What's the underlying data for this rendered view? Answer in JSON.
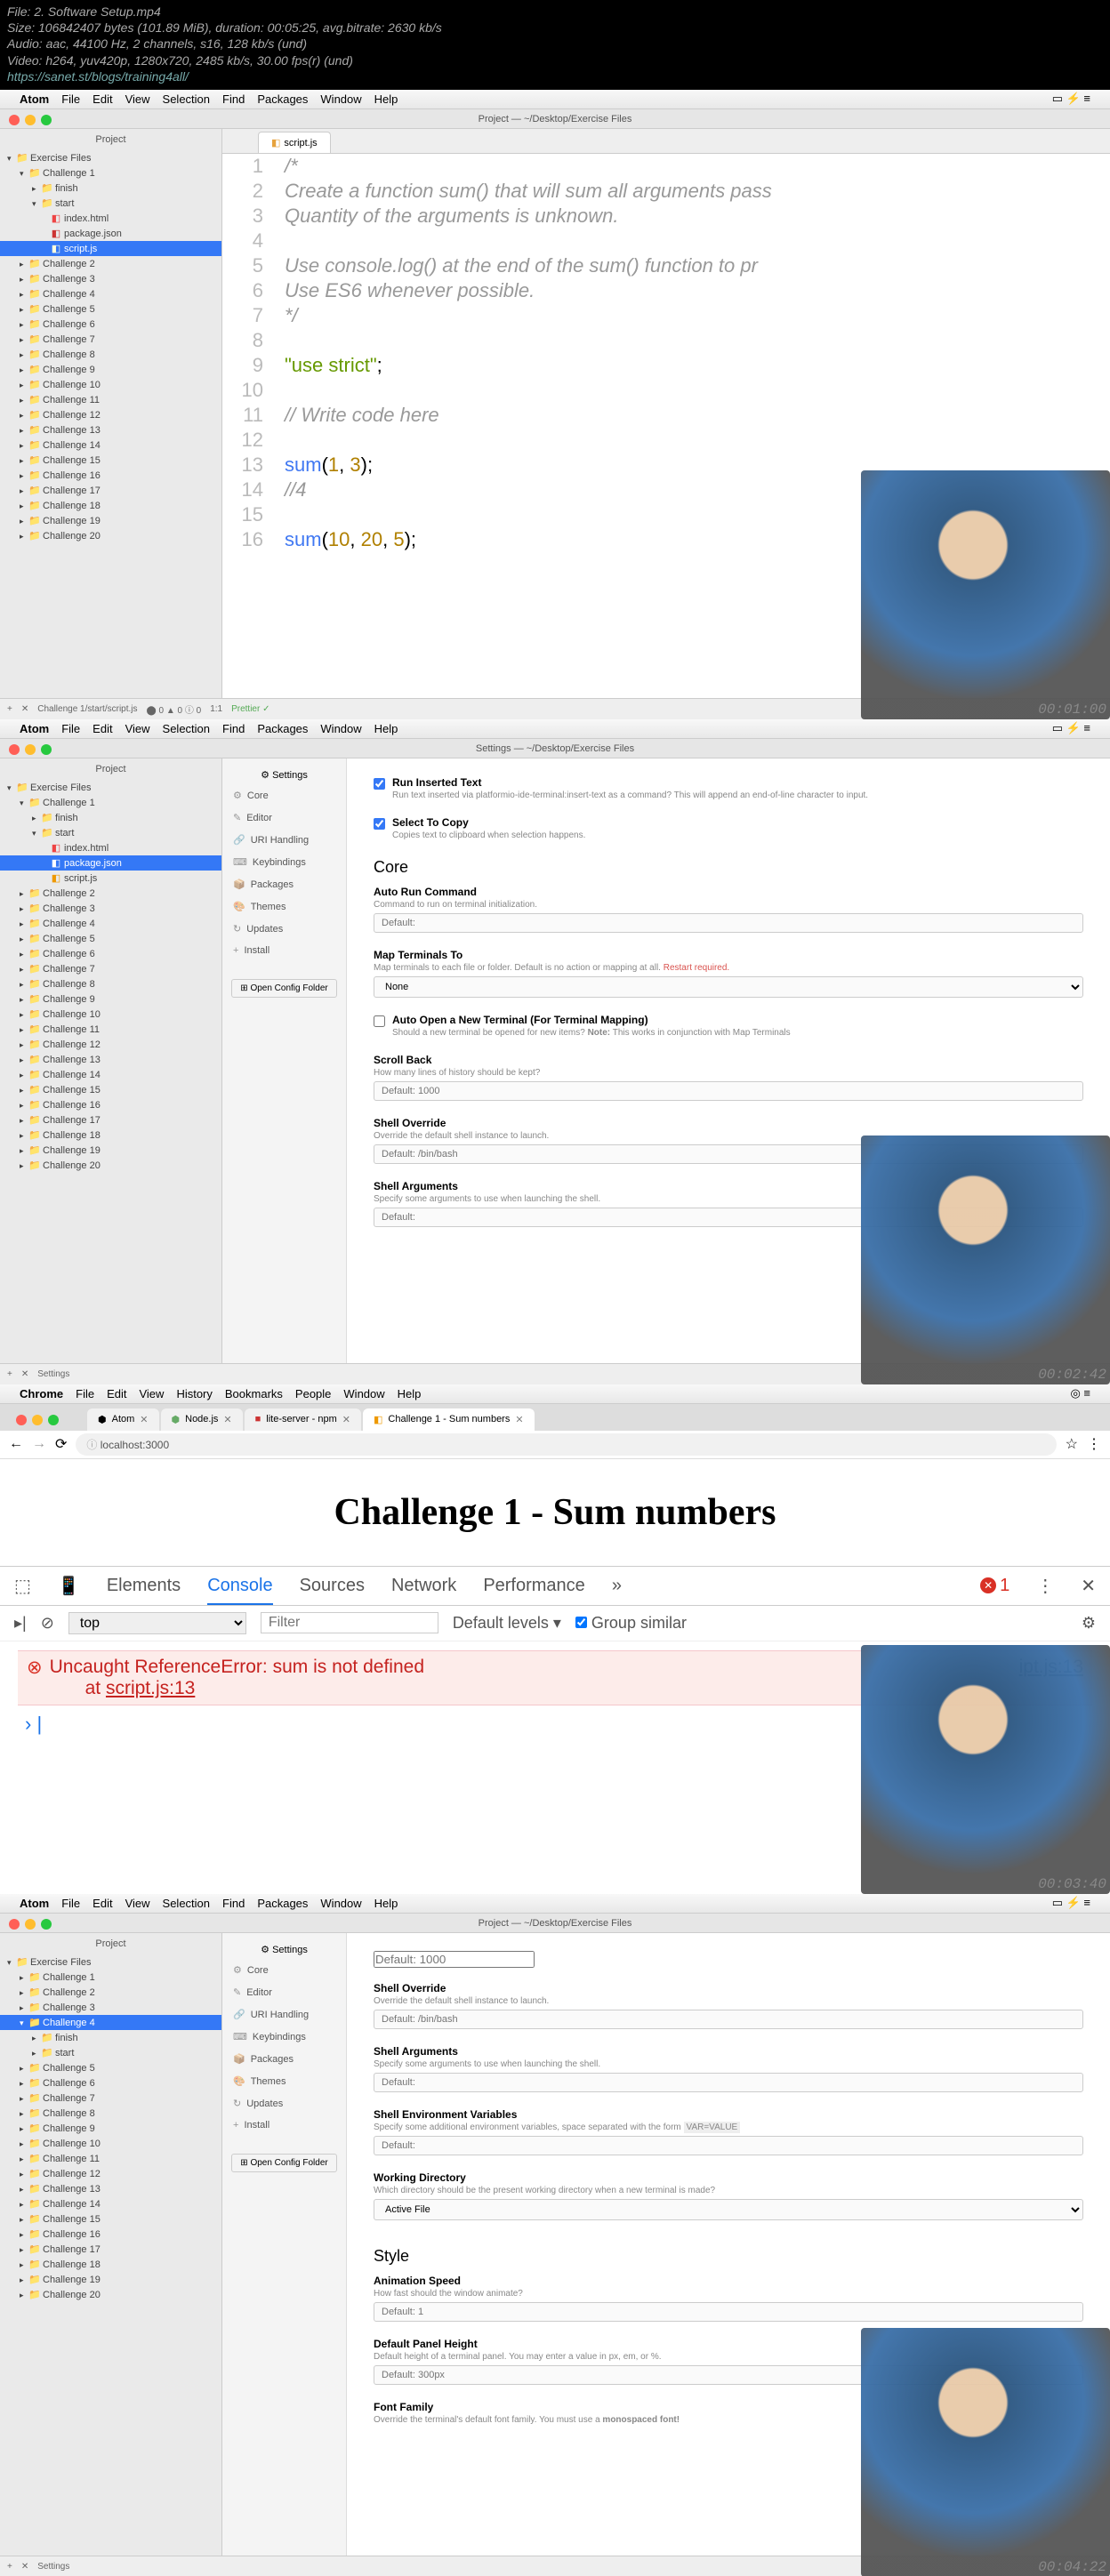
{
  "header": {
    "line1": "File: 2. Software Setup.mp4",
    "line2": "Size: 106842407 bytes (101.89 MiB), duration: 00:05:25, avg.bitrate: 2630 kb/s",
    "line3": "Audio: aac, 44100 Hz, 2 channels, s16, 128 kb/s (und)",
    "line4": "Video: h264, yuv420p, 1280x720, 2485 kb/s, 30.00 fps(r) (und)",
    "url": "https://sanet.st/blogs/training4all/"
  },
  "menubar": {
    "apple": "",
    "atom": "Atom",
    "chrome": "Chrome",
    "items": [
      "File",
      "Edit",
      "View",
      "Selection",
      "Find",
      "Packages",
      "Window",
      "Help"
    ],
    "chrome_items": [
      "File",
      "Edit",
      "View",
      "History",
      "Bookmarks",
      "People",
      "Window",
      "Help"
    ]
  },
  "panel1": {
    "title": "Project — ~/Desktop/Exercise Files",
    "sidebar_title": "Project",
    "tree": {
      "root": "Exercise Files",
      "challenge1": "Challenge 1",
      "finish": "finish",
      "start": "start",
      "index": "index.html",
      "package": "package.json",
      "script": "script.js",
      "challenges": [
        "Challenge 2",
        "Challenge 3",
        "Challenge 4",
        "Challenge 5",
        "Challenge 6",
        "Challenge 7",
        "Challenge 8",
        "Challenge 9",
        "Challenge 10",
        "Challenge 11",
        "Challenge 12",
        "Challenge 13",
        "Challenge 14",
        "Challenge 15",
        "Challenge 16",
        "Challenge 17",
        "Challenge 18",
        "Challenge 19",
        "Challenge 20"
      ]
    },
    "tab": "script.js",
    "code": {
      "l1": "/*",
      "l2": "Create a function sum() that will sum all arguments pass",
      "l3": "Quantity of the arguments is unknown.",
      "l4": "",
      "l5": "Use console.log() at the end of the sum() function to pr",
      "l6": "Use ES6 whenever possible.",
      "l7": "*/",
      "l8": "",
      "l9a": "\"use strict\"",
      "l9b": ";",
      "l10": "",
      "l11": "// Write code here",
      "l12": "",
      "l13a": "sum",
      "l13b": "(",
      "l13c": "1",
      "l13d": ", ",
      "l13e": "3",
      "l13f": ");",
      "l14": "//4",
      "l15": "",
      "l16a": "sum",
      "l16b": "(",
      "l16c": "10",
      "l16d": ", ",
      "l16e": "20",
      "l16f": ", ",
      "l16g": "5",
      "l16h": ");"
    },
    "statusbar": {
      "path": "Challenge 1/start/script.js",
      "pos": "1:1",
      "info": "⬤ 0 ▲ 0 ⓘ 0",
      "prettier": "Prettier ✓"
    },
    "timestamp": "00:01:00"
  },
  "panel2": {
    "title": "Settings — ~/Desktop/Exercise Files",
    "nav_title": "⚙ Settings",
    "nav": {
      "core": "Core",
      "editor": "Editor",
      "uri": "URI Handling",
      "keyb": "Keybindings",
      "pkg": "Packages",
      "themes": "Themes",
      "updates": "Updates",
      "install": "Install",
      "open_config": "⊞ Open Config Folder"
    },
    "settings": {
      "run_inserted": "Run Inserted Text",
      "run_inserted_desc_a": "Run text inserted via ",
      "run_inserted_desc_b": "platformio-ide-terminal:insert-text",
      "run_inserted_desc_c": " as a command? This will append an end-of-line character to input.",
      "select_copy": "Select To Copy",
      "select_copy_desc": "Copies text to clipboard when selection happens.",
      "core_h": "Core",
      "auto_run": "Auto Run Command",
      "auto_run_desc": "Command to run on terminal initialization.",
      "auto_run_ph": "Default:",
      "map_term": "Map Terminals To",
      "map_term_desc_a": "Map terminals to each file or folder. Default is no action or mapping at all. ",
      "map_term_desc_b": "Restart required.",
      "map_term_val": "None",
      "auto_open": "Auto Open a New Terminal (For Terminal Mapping)",
      "auto_open_desc_a": "Should a new terminal be opened for new items? ",
      "auto_open_desc_b": "Note:",
      "auto_open_desc_c": " This works in conjunction with ",
      "auto_open_desc_d": "Map Terminals",
      "scroll_back": "Scroll Back",
      "scroll_back_desc": "How many lines of history should be kept?",
      "scroll_back_ph": "Default: 1000",
      "shell_override": "Shell Override",
      "shell_override_desc": "Override the default shell instance to launch.",
      "shell_override_ph": "Default: /bin/bash",
      "shell_args": "Shell Arguments",
      "shell_args_desc": "Specify some arguments to use when launching the shell.",
      "shell_args_ph": "Default:"
    },
    "statusbar_text": "Settings",
    "timestamp": "00:02:42"
  },
  "panel3": {
    "tabs": {
      "atom": "Atom",
      "nodejs": "Node.js",
      "lite": "lite-server - npm",
      "challenge": "Challenge 1 - Sum numbers"
    },
    "url": "localhost:3000",
    "page_title": "Challenge 1 - Sum numbers",
    "devtools": {
      "elements": "Elements",
      "console": "Console",
      "sources": "Sources",
      "network": "Network",
      "performance": "Performance",
      "err_count": "1",
      "top": "top",
      "filter_ph": "Filter",
      "levels": "Default levels ▾",
      "group": "Group similar",
      "error_msg": "Uncaught ReferenceError: sum is not defined",
      "error_at": "at ",
      "error_link": "script.js:13",
      "error_loc": "ipt.js:13"
    },
    "timestamp": "00:03:40"
  },
  "panel4": {
    "title": "Project — ~/Desktop/Exercise Files",
    "tree": {
      "root": "Exercise Files",
      "c1": "Challenge 1",
      "c2": "Challenge 2",
      "c3": "Challenge 3",
      "c4": "Challenge 4",
      "finish": "finish",
      "start": "start",
      "c5": "Challenge 5",
      "c6": "Challenge 6",
      "c7": "Challenge 7",
      "c8": "Challenge 8",
      "c9": "Challenge 9",
      "c10": "Challenge 10",
      "c11": "Challenge 11",
      "c12": "Challenge 12",
      "c13": "Challenge 13",
      "c14": "Challenge 14",
      "c15": "Challenge 15",
      "c16": "Challenge 16",
      "c17": "Challenge 17",
      "c18": "Challenge 18",
      "c19": "Challenge 19",
      "c20": "Challenge 20"
    },
    "settings": {
      "default1000": "Default: 1000",
      "shell_override": "Shell Override",
      "shell_override_desc": "Override the default shell instance to launch.",
      "shell_override_ph": "Default: /bin/bash",
      "shell_args": "Shell Arguments",
      "shell_args_desc": "Specify some arguments to use when launching the shell.",
      "shell_args_ph": "Default:",
      "shell_env": "Shell Environment Variables",
      "shell_env_desc_a": "Specify some additional environment variables, space separated with the form ",
      "shell_env_desc_b": "VAR=VALUE",
      "shell_env_ph": "Default:",
      "work_dir": "Working Directory",
      "work_dir_desc": "Which directory should be the present working directory when a new terminal is made?",
      "work_dir_val": "Active File",
      "style_h": "Style",
      "anim": "Animation Speed",
      "anim_desc": "How fast should the window animate?",
      "anim_ph": "Default: 1",
      "panel_h": "Default Panel Height",
      "panel_h_desc": "Default height of a terminal panel. You may enter a value in px, em, or %.",
      "panel_h_ph": "Default: 300px",
      "font_fam": "Font Family",
      "font_fam_desc_a": "Override the terminal's default font family. You must use a ",
      "font_fam_desc_b": "monospaced font!"
    },
    "statusbar_text": "Settings",
    "timestamp": "00:04:22"
  }
}
